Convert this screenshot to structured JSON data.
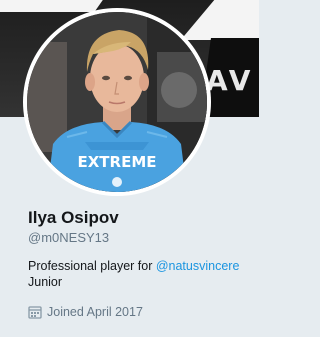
{
  "banner": {
    "text": "AV"
  },
  "avatar": {
    "shirt_text": "EXTREME",
    "alt": "Ilya Osipov profile photo"
  },
  "profile": {
    "name": "Ilya Osipov",
    "handle": "@m0NESY13",
    "bio_prefix": "Professional player for ",
    "bio_mention": "@natusvincere",
    "bio_suffix": "Junior",
    "joined_icon": "calendar-icon",
    "joined": "Joined April 2017"
  },
  "colors": {
    "background": "#e6ecf0",
    "link": "#1b95e0",
    "muted": "#657786",
    "text": "#14171a"
  }
}
